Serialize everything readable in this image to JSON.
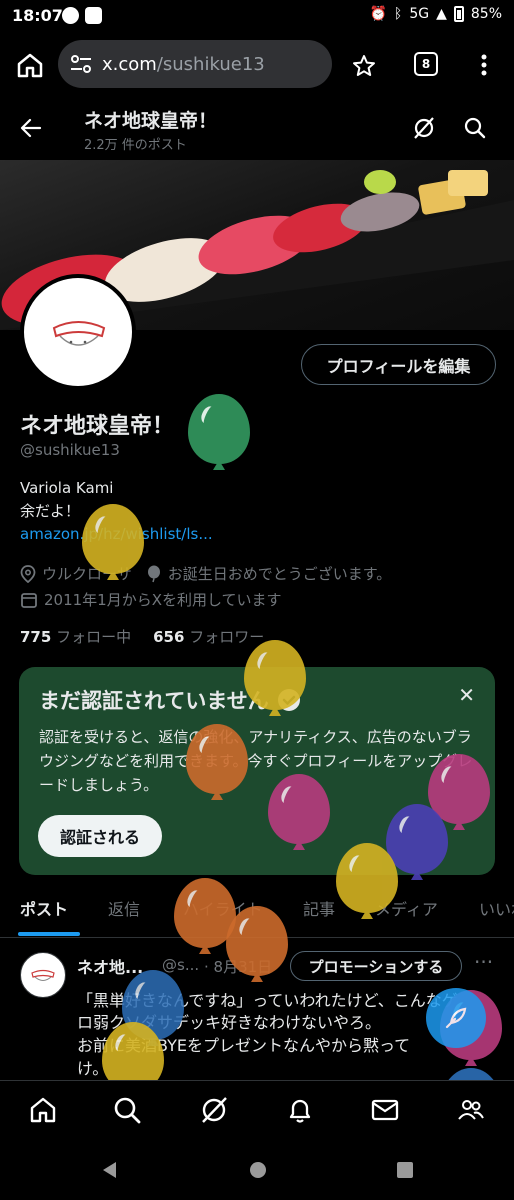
{
  "status_bar": {
    "time": "18:07",
    "network": "5G",
    "battery": "85%"
  },
  "browser": {
    "url_host": "x.com",
    "url_path": "/sushikue13",
    "tab_count": "8"
  },
  "header": {
    "title": "ネオ地球皇帝！",
    "post_count": "2.2万 件のポスト"
  },
  "profile": {
    "edit_button": "プロフィールを編集",
    "name": "ネオ地球皇帝！",
    "handle": "@sushikue13",
    "bio_line1": "Variola Kami",
    "bio_line2": "余だよ！",
    "link": "amazon.jp/hz/wishlist/ls...",
    "location": "ウルクローサ",
    "birthday": "お誕生日おめでとうございます。",
    "joined": "2011年1月からXを利用しています",
    "following_count": "775",
    "following_label": "フォロー中",
    "followers_count": "656",
    "followers_label": "フォロワー"
  },
  "verify_card": {
    "title": "まだ認証されていません",
    "body": "認証を受けると、返信の強化、アナリティクス、広告のないブラウジングなどを利用できます。今すぐプロフィールをアップグレードしましょう。",
    "button": "認証される"
  },
  "tabs": [
    "ポスト",
    "返信",
    "ハイライト",
    "記事",
    "メディア",
    "いいね"
  ],
  "post": {
    "name": "ネオ地...",
    "handle": "@s...",
    "date": "· 8月31日",
    "promote": "プロモーションする",
    "line1": "「黒単好きなんですね」っていわれたけど、こんなゲ",
    "line2": "ロ弱クソダサデッキ好きなわけないやろ。",
    "line3": "お前に美酒BYEをプレゼントなんやから黙って",
    "line4": "け。"
  },
  "colors": {
    "accent": "#1d9bf0",
    "verify_bg": "#1d4a2e",
    "background": "#000000"
  }
}
